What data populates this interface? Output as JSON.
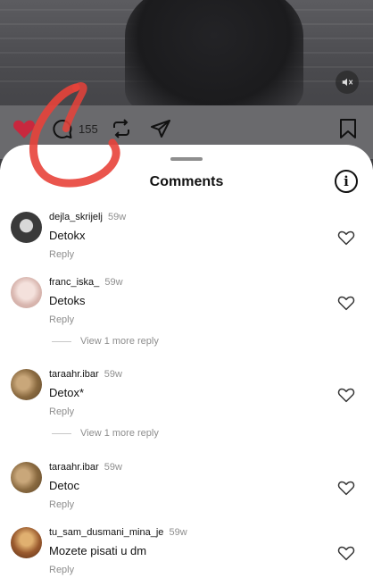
{
  "post": {
    "comment_count": "155",
    "colors": {
      "like": "#e0324b",
      "annotation": "#e8423a"
    }
  },
  "sheet": {
    "title": "Comments"
  },
  "comments": [
    {
      "username": "dejla_skrijelj",
      "time": "59w",
      "text": "Detokx",
      "reply_label": "Reply",
      "avatar_color": "#3a3a3a"
    },
    {
      "username": "franc_iska_",
      "time": "59w",
      "text": "Detoks",
      "reply_label": "Reply",
      "more_replies": "View 1 more reply",
      "avatar_color": "#e8c9c4"
    },
    {
      "username": "taraahr.ibar",
      "time": "59w",
      "text": "Detox*",
      "reply_label": "Reply",
      "more_replies": "View 1 more reply",
      "avatar_color": "#a5865a"
    },
    {
      "username": "taraahr.ibar",
      "time": "59w",
      "text": "Detoc",
      "reply_label": "Reply",
      "avatar_color": "#a5865a"
    },
    {
      "username": "tu_sam_dusmani_mina_je",
      "time": "59w",
      "text": "Mozete pisati u dm",
      "reply_label": "Reply",
      "avatar_color": "#8a5a3a"
    }
  ]
}
